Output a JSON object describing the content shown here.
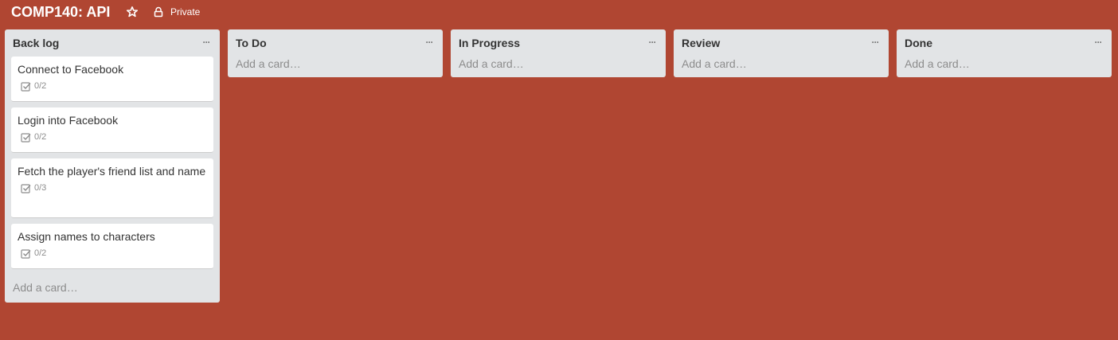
{
  "board": {
    "title": "COMP140: API",
    "star_icon": "star-icon",
    "visibility_icon": "lock-icon",
    "visibility_label": "Private",
    "background_color": "#b04632"
  },
  "lists": [
    {
      "title": "Back log",
      "menu_label": "···",
      "add_card_label": "Add a card…",
      "cards": [
        {
          "title": "Connect to Facebook",
          "checklist": "0/2"
        },
        {
          "title": "Login into Facebook",
          "checklist": "0/2"
        },
        {
          "title": "Fetch the player's friend list and name",
          "checklist": "0/3"
        },
        {
          "title": "Assign names to characters",
          "checklist": "0/2"
        }
      ]
    },
    {
      "title": "To Do",
      "menu_label": "···",
      "add_card_label": "Add a card…",
      "cards": []
    },
    {
      "title": "In Progress",
      "menu_label": "···",
      "add_card_label": "Add a card…",
      "cards": []
    },
    {
      "title": "Review",
      "menu_label": "···",
      "add_card_label": "Add a card…",
      "cards": []
    },
    {
      "title": "Done",
      "menu_label": "···",
      "add_card_label": "Add a card…",
      "cards": []
    }
  ]
}
